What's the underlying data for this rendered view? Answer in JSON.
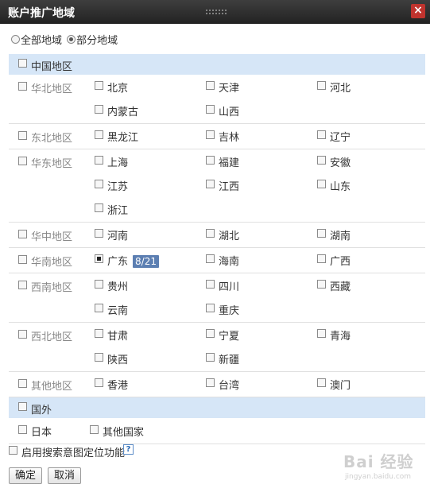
{
  "dialog": {
    "title": "账户推广地域",
    "close_label": "×"
  },
  "scope": {
    "all_label": "全部地域",
    "partial_label": "部分地域",
    "selected": "partial"
  },
  "china": {
    "header": "中国地区",
    "regions": [
      {
        "name": "华北地区",
        "provinces": [
          "北京",
          "天津",
          "河北",
          "内蒙古",
          "山西"
        ]
      },
      {
        "name": "东北地区",
        "provinces": [
          "黑龙江",
          "吉林",
          "辽宁"
        ]
      },
      {
        "name": "华东地区",
        "provinces": [
          "上海",
          "福建",
          "安徽",
          "江苏",
          "江西",
          "山东",
          "浙江"
        ]
      },
      {
        "name": "华中地区",
        "provinces": [
          "河南",
          "湖北",
          "湖南"
        ]
      },
      {
        "name": "华南地区",
        "provinces": [
          "广东",
          "海南",
          "广西"
        ],
        "badge": "8/21"
      },
      {
        "name": "西南地区",
        "provinces": [
          "贵州",
          "四川",
          "西藏",
          "云南",
          "重庆"
        ]
      },
      {
        "name": "西北地区",
        "provinces": [
          "甘肃",
          "宁夏",
          "青海",
          "陕西",
          "新疆"
        ]
      },
      {
        "name": "其他地区",
        "provinces": [
          "香港",
          "台湾",
          "澳门"
        ]
      }
    ]
  },
  "foreign": {
    "header": "国外",
    "items": [
      "日本",
      "其他国家"
    ]
  },
  "intent": {
    "label": "启用搜索意图定位功能",
    "help": "?"
  },
  "buttons": {
    "confirm": "确定",
    "cancel": "取消"
  },
  "watermark": {
    "main": "Bai 经验",
    "sub": "jingyan.baidu.com"
  },
  "colors": {
    "titlebar": "#2b2b2b",
    "header_bg": "#d6e6f7",
    "badge": "#5c7fb2",
    "close": "#c0332e"
  }
}
